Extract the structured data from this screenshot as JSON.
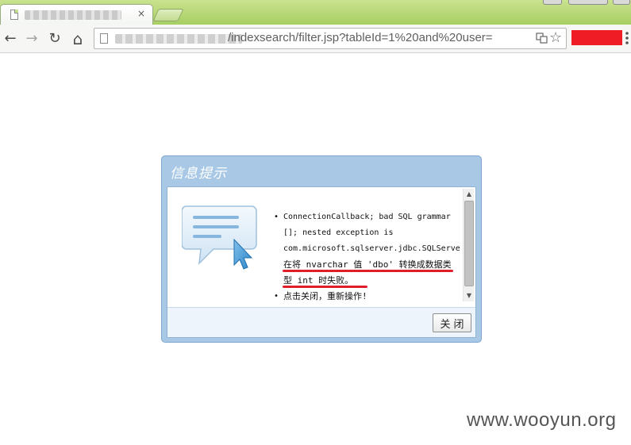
{
  "browser": {
    "tab_close_glyph": "×",
    "back_glyph": "←",
    "forward_glyph": "→",
    "reload_glyph": "↻",
    "home_glyph": "⌂",
    "url_path": "/indexsearch/filter.jsp?tableId=1%20and%20user=",
    "star_glyph": "☆",
    "menu_glyph": "≡"
  },
  "dialog": {
    "title": "信息提示",
    "messages": [
      [
        "ConnectionCallback; bad SQL grammar",
        "[]; nested exception is",
        "com.microsoft.sqlserver.jdbc.SQLServerException:",
        "在将 nvarchar 值 'dbo' 转换成数据类",
        "型 int 时失败。"
      ],
      [
        "点击关闭，重新操作!"
      ]
    ],
    "close_label": "关闭"
  },
  "scrollbar": {
    "up_glyph": "▲",
    "down_glyph": "▼"
  },
  "watermark": "www.wooyun.org",
  "colors": {
    "tab_strip": "#b5d679",
    "dialog_frame": "#a8c8e6",
    "highlight": "#e01e2a",
    "extension": "#ef1c25"
  }
}
